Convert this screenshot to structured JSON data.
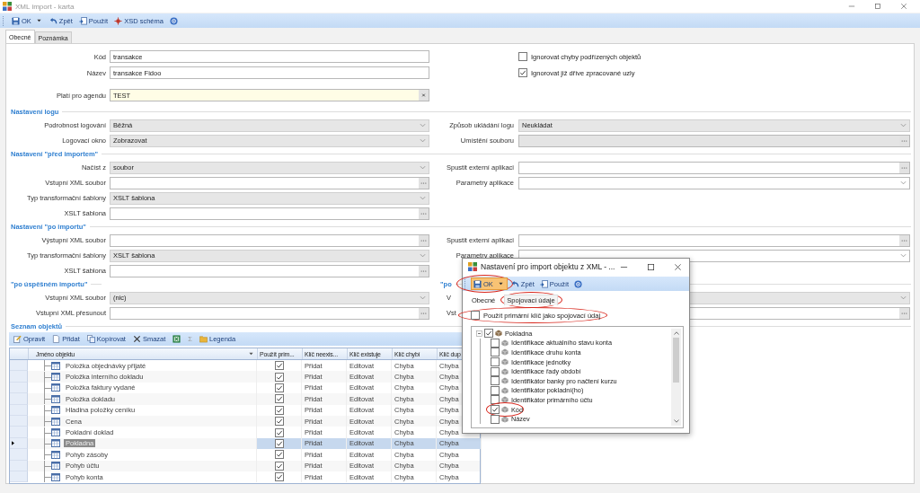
{
  "window": {
    "title": "XML import - karta"
  },
  "toolbar": [
    {
      "label": "OK",
      "dropdown": true
    },
    {
      "label": "Zpět",
      "dropdown": false
    },
    {
      "label": "Použít",
      "dropdown": false
    },
    {
      "label": "XSD schéma",
      "dropdown": false
    },
    {
      "dropdown": false
    }
  ],
  "tabs": [
    {
      "label": "Obecné",
      "selected": true
    },
    {
      "label": "Poznámka",
      "selected": false
    }
  ],
  "header_fields": [
    {
      "label": "Kód",
      "value": "transakce",
      "kind": "text"
    },
    {
      "label": "Název",
      "value": "transakce Fidoo",
      "kind": "text"
    },
    {
      "label": "Platí pro agendu",
      "value": "TEST",
      "kind": "lookup"
    }
  ],
  "options": [
    {
      "label": "Ignorovat chyby podřízených objektů",
      "checked": false
    },
    {
      "label": "Ignorovat již dříve zpracované uzly",
      "checked": true
    }
  ],
  "sections": [
    {
      "title": "Nastavení logu",
      "left": [
        {
          "label": "Podrobnost logování",
          "value": "Běžná",
          "kind": "list"
        },
        {
          "label": "Logovací okno",
          "value": "Zobrazovat",
          "kind": "list"
        }
      ],
      "right": [
        {
          "label": "Způsob ukládání logu",
          "value": "Neukládat",
          "kind": "list"
        },
        {
          "label": "Umístění souboru",
          "kind": "locked"
        }
      ]
    },
    {
      "title": "Nastavení \"před importem\"",
      "left": [
        {
          "label": "Načíst z",
          "value": "soubor",
          "kind": "list"
        },
        {
          "label": "Vstupní XML soubor",
          "kind": "browse"
        },
        {
          "label": "Typ transformační šablony",
          "value": "XSLT šablona",
          "kind": "list"
        },
        {
          "label": "XSLT šablona",
          "kind": "browse"
        }
      ],
      "right": [
        {
          "label": "Spustit externí aplikaci",
          "kind": "browse"
        },
        {
          "label": "Parametry aplikace",
          "kind": "combo"
        }
      ]
    },
    {
      "title": "Nastavení \"po importu\"",
      "left": [
        {
          "label": "Výstupní XML soubor",
          "kind": "browse"
        },
        {
          "label": "Typ transformační šablony",
          "value": "XSLT šablona",
          "kind": "list"
        },
        {
          "label": "XSLT šablona",
          "kind": "browse"
        }
      ],
      "right": [
        {
          "label": "Spustit externí aplikaci",
          "kind": "browse"
        },
        {
          "label": "Parametry aplikace",
          "kind": "combo"
        }
      ]
    },
    {
      "title": "\"po úspěšném importu\"",
      "right_title": "\"po",
      "left": [
        {
          "label": "Vstupní XML soubor",
          "value": "(nic)",
          "kind": "list"
        },
        {
          "label": "Vstupní XML přesunout",
          "kind": "browse"
        }
      ],
      "right": [
        {
          "label": "V",
          "kind": "list"
        },
        {
          "label": "Vst",
          "kind": "browse"
        }
      ]
    }
  ],
  "objects": {
    "title": "Seznam objektů",
    "toolbar": [
      {
        "label": "Opravit",
        "disabled": false
      },
      {
        "label": "Přidat",
        "disabled": false
      },
      {
        "label": "Kopírovat",
        "disabled": false
      },
      {
        "label": "Smazat",
        "disabled": false
      },
      {
        "disabled": false
      },
      {
        "label": "Σ",
        "disabled": true
      },
      {
        "label": "Legenda",
        "disabled": false
      }
    ],
    "columns": [
      "Jméno objektu",
      "Použít prim...",
      "Klíč neexis...",
      "Klíč existuje",
      "Klíč chybí",
      "Klíč dup"
    ],
    "rows": [
      {
        "cells": [
          "Položka objednávky přijaté",
          "",
          "Přidat",
          "Editovat",
          "Chyba",
          "Chyba"
        ],
        "use_primary": true,
        "selected": false
      },
      {
        "cells": [
          "Položka interního dokladu",
          "",
          "Přidat",
          "Editovat",
          "Chyba",
          "Chyba"
        ],
        "use_primary": true,
        "selected": false
      },
      {
        "cells": [
          "Položka faktury vydané",
          "",
          "Přidat",
          "Editovat",
          "Chyba",
          "Chyba"
        ],
        "use_primary": true,
        "selected": false
      },
      {
        "cells": [
          "Položka dokladu",
          "",
          "Přidat",
          "Editovat",
          "Chyba",
          "Chyba"
        ],
        "use_primary": true,
        "selected": false
      },
      {
        "cells": [
          "Hladina položky ceníku",
          "",
          "Přidat",
          "Editovat",
          "Chyba",
          "Chyba"
        ],
        "use_primary": true,
        "selected": false
      },
      {
        "cells": [
          "Cena",
          "",
          "Přidat",
          "Editovat",
          "Chyba",
          "Chyba"
        ],
        "use_primary": true,
        "selected": false
      },
      {
        "cells": [
          "Pokladní doklad",
          "",
          "Přidat",
          "Editovat",
          "Chyba",
          "Chyba"
        ],
        "use_primary": true,
        "selected": false
      },
      {
        "cells": [
          "Pokladna",
          "",
          "Přidat",
          "Editovat",
          "Chyba",
          "Chyba"
        ],
        "use_primary": true,
        "selected": true
      },
      {
        "cells": [
          "Pohyb zásoby",
          "",
          "Přidat",
          "Editovat",
          "Chyba",
          "Chyba"
        ],
        "use_primary": true,
        "selected": false
      },
      {
        "cells": [
          "Pohyb účtu",
          "",
          "Přidat",
          "Editovat",
          "Chyba",
          "Chyba"
        ],
        "use_primary": true,
        "selected": false
      },
      {
        "cells": [
          "Pohyb konta",
          "",
          "Přidat",
          "Editovat",
          "Chyba",
          "Chyba"
        ],
        "use_primary": true,
        "selected": false
      }
    ]
  },
  "dialog": {
    "title": "Nastavení pro import objektu z XML - ...",
    "toolbar": [
      {
        "label": "OK",
        "dropdown": true,
        "pressed": true,
        "marked": true
      },
      {
        "label": "Zpět",
        "dropdown": false,
        "pressed": false,
        "marked": false
      },
      {
        "label": "Použít",
        "dropdown": false,
        "pressed": false,
        "marked": false
      },
      {
        "dropdown": false,
        "pressed": false,
        "marked": false
      }
    ],
    "tabs": [
      {
        "label": "Obecné",
        "selected": false,
        "marked": false
      },
      {
        "label": "Spojovací údaje",
        "selected": true,
        "marked": true
      }
    ],
    "option": {
      "label": "Použít primární klíč jako spojovací údaj",
      "checked": false,
      "marked": true
    },
    "tree": {
      "label": "Pokladna",
      "checked": true,
      "expanded": true,
      "marked": false,
      "children": [
        {
          "label": "Identifikace aktuálního stavu konta",
          "checked": false,
          "marked": false
        },
        {
          "label": "Identifikace druhu konta",
          "checked": false,
          "marked": false
        },
        {
          "label": "Identifikace jednotky",
          "checked": false,
          "marked": false
        },
        {
          "label": "Identifikace řady období",
          "checked": false,
          "marked": false
        },
        {
          "label": "Identifikátor banky pro načtení kurzu",
          "checked": false,
          "marked": false
        },
        {
          "label": "Identifikátor pokladní(ho)",
          "checked": false,
          "marked": false
        },
        {
          "label": "Identifikátor primárního účtu",
          "checked": false,
          "marked": false
        },
        {
          "label": "Kód",
          "checked": true,
          "marked": true
        },
        {
          "label": "Název",
          "checked": false,
          "marked": false
        }
      ]
    }
  }
}
